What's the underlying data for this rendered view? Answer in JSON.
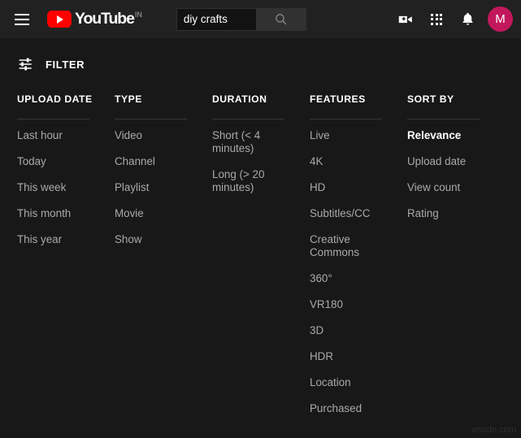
{
  "masthead": {
    "menu_icon": "hamburger-menu-icon",
    "logo": {
      "wordmark": "YouTube",
      "country_code": "IN",
      "play_icon": "youtube-play-icon",
      "brand_color": "#FF0000"
    },
    "search": {
      "value": "diy crafts",
      "placeholder": "Search",
      "button_icon": "search-icon"
    },
    "actions": [
      {
        "name": "create-video-icon",
        "label": "Create"
      },
      {
        "name": "apps-grid-icon",
        "label": "YouTube apps"
      },
      {
        "name": "notifications-bell-icon",
        "label": "Notifications"
      }
    ],
    "avatar": {
      "initial": "M",
      "color": "#C2185B"
    }
  },
  "filter_bar": {
    "label": "FILTER",
    "icon": "tune-filter-icon"
  },
  "filter_columns": [
    {
      "header": "UPLOAD DATE",
      "items": [
        {
          "label": "Last hour",
          "selected": false
        },
        {
          "label": "Today",
          "selected": false
        },
        {
          "label": "This week",
          "selected": false
        },
        {
          "label": "This month",
          "selected": false
        },
        {
          "label": "This year",
          "selected": false
        }
      ]
    },
    {
      "header": "TYPE",
      "items": [
        {
          "label": "Video",
          "selected": false
        },
        {
          "label": "Channel",
          "selected": false
        },
        {
          "label": "Playlist",
          "selected": false
        },
        {
          "label": "Movie",
          "selected": false
        },
        {
          "label": "Show",
          "selected": false
        }
      ]
    },
    {
      "header": "DURATION",
      "items": [
        {
          "label": "Short (< 4 minutes)",
          "selected": false
        },
        {
          "label": "Long (> 20 minutes)",
          "selected": false
        }
      ]
    },
    {
      "header": "FEATURES",
      "items": [
        {
          "label": "Live",
          "selected": false
        },
        {
          "label": "4K",
          "selected": false
        },
        {
          "label": "HD",
          "selected": false
        },
        {
          "label": "Subtitles/CC",
          "selected": false
        },
        {
          "label": "Creative Commons",
          "selected": false
        },
        {
          "label": "360°",
          "selected": false
        },
        {
          "label": "VR180",
          "selected": false
        },
        {
          "label": "3D",
          "selected": false
        },
        {
          "label": "HDR",
          "selected": false
        },
        {
          "label": "Location",
          "selected": false
        },
        {
          "label": "Purchased",
          "selected": false
        }
      ]
    },
    {
      "header": "SORT BY",
      "items": [
        {
          "label": "Relevance",
          "selected": true
        },
        {
          "label": "Upload date",
          "selected": false
        },
        {
          "label": "View count",
          "selected": false
        },
        {
          "label": "Rating",
          "selected": false
        }
      ]
    }
  ],
  "watermark": "wsxdn.com"
}
